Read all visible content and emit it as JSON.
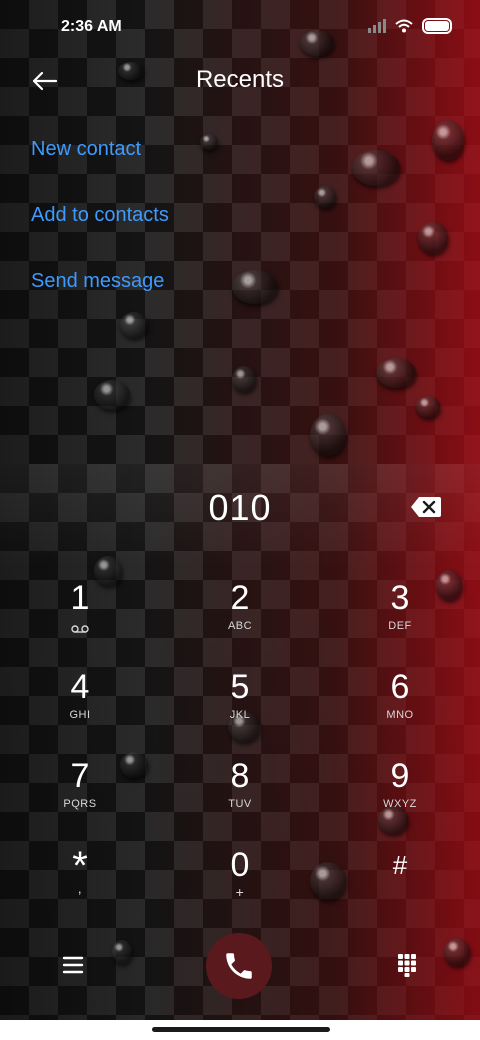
{
  "status_bar": {
    "time": "2:36 AM",
    "icons": [
      "signal-icon",
      "wifi-icon",
      "battery-icon"
    ]
  },
  "header": {
    "title": "Recents",
    "back_icon": "back-arrow-icon"
  },
  "actions": {
    "new_contact": "New contact",
    "add_to_contacts": "Add to contacts",
    "send_message": "Send message"
  },
  "dialer": {
    "number": "010",
    "backspace_icon": "backspace-icon",
    "keys": [
      {
        "digit": "1",
        "letters": "",
        "sub_icon": "voicemail-icon"
      },
      {
        "digit": "2",
        "letters": "ABC"
      },
      {
        "digit": "3",
        "letters": "DEF"
      },
      {
        "digit": "4",
        "letters": "GHI"
      },
      {
        "digit": "5",
        "letters": "JKL"
      },
      {
        "digit": "6",
        "letters": "MNO"
      },
      {
        "digit": "7",
        "letters": "PQRS"
      },
      {
        "digit": "8",
        "letters": "TUV"
      },
      {
        "digit": "9",
        "letters": "WXYZ"
      },
      {
        "digit": "*",
        "letters": ","
      },
      {
        "digit": "0",
        "letters": "+"
      },
      {
        "digit": "#",
        "letters": ""
      }
    ]
  },
  "bottom_actions": {
    "menu_icon": "menu-icon",
    "call_icon": "phone-icon",
    "dialpad_icon": "dialpad-icon"
  },
  "colors": {
    "link": "#3d9bff",
    "call_button": "#5a1a1d",
    "accent_red": "#c0141e"
  }
}
